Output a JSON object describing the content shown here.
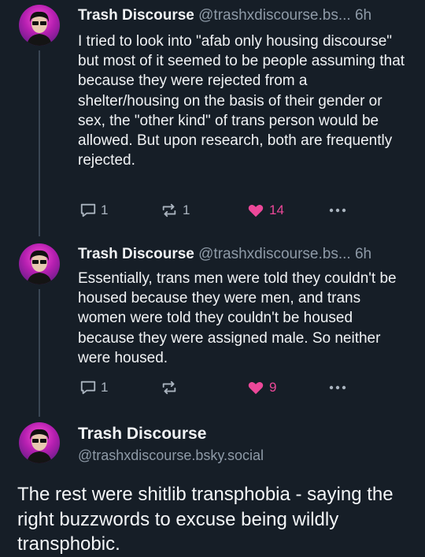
{
  "posts": [
    {
      "author": "Trash Discourse",
      "handle": "@trashxdiscourse.bs...",
      "time": "6h",
      "text": "I tried to look into \"afab only housing discourse\" but most of it seemed to be people assuming that because they were rejected from a shelter/housing on the basis of their gender or sex, the \"other kind\" of trans person would be allowed. But upon research, both are frequently rejected.",
      "replies": "1",
      "reposts": "1",
      "likes": "14"
    },
    {
      "author": "Trash Discourse",
      "handle": "@trashxdiscourse.bs...",
      "time": "6h",
      "text": "Essentially, trans men were told they couldn't be housed because they were men, and trans women were told they couldn't be housed because they were assigned male.  So neither were housed.",
      "replies": "1",
      "reposts": "",
      "likes": "9"
    }
  ],
  "main_post": {
    "author": "Trash Discourse",
    "handle": "@trashxdiscourse.bsky.social",
    "text": "The rest were shitlib transphobia - saying the right buzzwords to excuse being wildly transphobic."
  },
  "colors": {
    "background": "#161e27",
    "muted": "#8e9aa7",
    "like": "#ec4899",
    "thread_line": "#3a4654"
  },
  "icons": [
    "reply-icon",
    "repost-icon",
    "heart-icon",
    "more-icon",
    "avatar"
  ]
}
